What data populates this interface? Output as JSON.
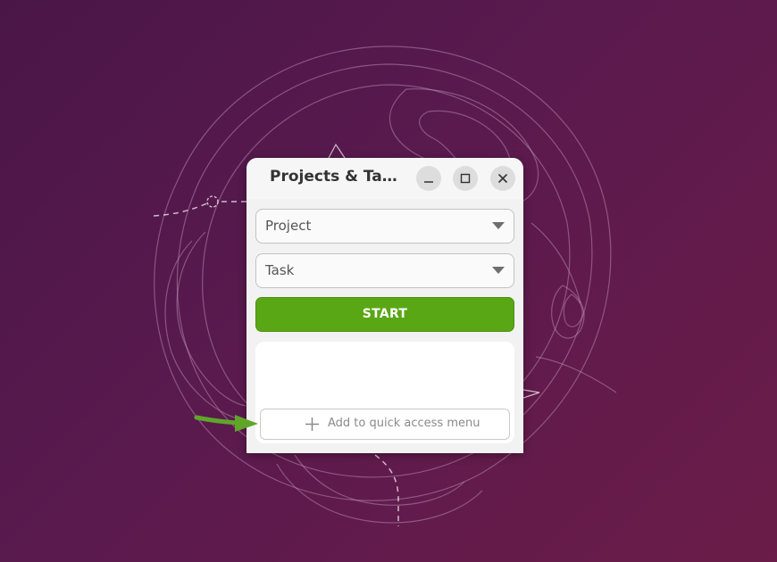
{
  "window": {
    "title": "Projects & Ta…",
    "controls": {
      "minimize_icon": "minimize-icon",
      "maximize_icon": "maximize-icon",
      "close_icon": "close-icon"
    }
  },
  "form": {
    "project_select": "Project",
    "task_select": "Task",
    "start_label": "START"
  },
  "quick_access": {
    "add_label": "Add to quick access menu",
    "add_icon": "plus-icon"
  },
  "annotation": {
    "icon": "green-arrow-icon",
    "color": "#5fa52a"
  },
  "colors": {
    "accent": "#59a715",
    "wallpaper": "#5a1a4e"
  }
}
